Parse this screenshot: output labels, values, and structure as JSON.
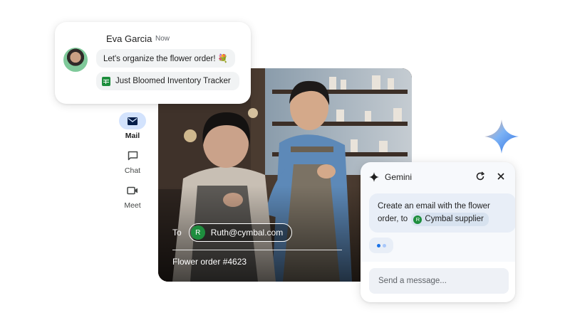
{
  "notification": {
    "sender": "Eva Garcia",
    "time": "Now",
    "message": "Let's organize the flower order! 💐",
    "attachment": "Just Bloomed Inventory Tracker",
    "avatar_icon": "user-avatar"
  },
  "rail": {
    "items": [
      {
        "label": "Mail",
        "icon": "mail-icon",
        "active": true
      },
      {
        "label": "Chat",
        "icon": "chat-icon",
        "active": false
      },
      {
        "label": "Meet",
        "icon": "video-icon",
        "active": false
      }
    ]
  },
  "compose": {
    "to_label": "To",
    "recipient_initial": "R",
    "recipient": "Ruth@cymbal.com",
    "subject": "Flower order #4623"
  },
  "gemini": {
    "title": "Gemini",
    "prompt_text": "Create an email with the flower order, to",
    "chip_initial": "R",
    "chip_label": "Cymbal supplier",
    "input_placeholder": "Send a message..."
  },
  "colors": {
    "accent_blue": "#d3e3fd",
    "chip_green": "#1e8e3e",
    "gemini_panel": "#f7f9fc"
  }
}
